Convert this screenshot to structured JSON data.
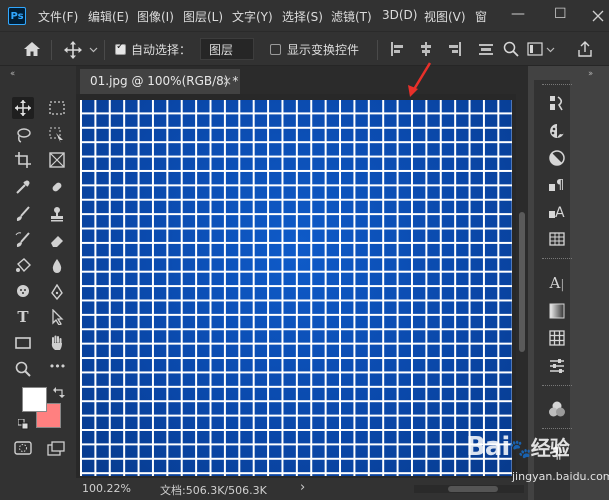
{
  "app": {
    "logo": "Ps"
  },
  "menu": [
    "文件(F)",
    "编辑(E)",
    "图像(I)",
    "图层(L)",
    "文字(Y)",
    "选择(S)",
    "滤镜(T)",
    "3D(D)",
    "视图(V)",
    "窗"
  ],
  "window_controls": {
    "minimize": "—",
    "maximize": "☐"
  },
  "options": {
    "auto_select_label": "自动选择：",
    "auto_select_checked": true,
    "target_value": "图层",
    "show_transform_label": "显示变换控件",
    "show_transform_checked": false
  },
  "document_tab": {
    "title": "01.jpg @ 100%(RGB/8) *",
    "close": "×"
  },
  "status": {
    "zoom": "100.22%",
    "doc_info": "文档:506.3K/506.3K",
    "arrow": "›"
  },
  "colors": {
    "foreground": "#ffffff",
    "background": "#ff8080",
    "accent": "#31a8ff",
    "image_blue": "#0a47a8",
    "annotation_arrow": "#e8302a"
  },
  "tools_left": [
    "move-tool",
    "marquee-tool",
    "lasso-tool",
    "object-select-tool",
    "crop-tool",
    "frame-tool",
    "eyedropper-tool",
    "healing-brush-tool",
    "brush-tool",
    "clone-stamp-tool",
    "history-brush-tool",
    "eraser-tool",
    "paint-bucket-tool",
    "blur-tool",
    "dodge-tool",
    "pen-tool",
    "type-tool",
    "path-select-tool",
    "rectangle-tool",
    "hand-tool",
    "zoom-tool",
    "more-tools",
    "quick-mask",
    "screen-mode"
  ],
  "tool_glyphs": {
    "type": "T",
    "more": "•••"
  },
  "right_panel_icons": [
    "history-icon",
    "color-icon",
    "adjustments-icon",
    "styles-icon",
    "character-icon",
    "grid-icon",
    "glyph-icon",
    "gradient-icon",
    "pattern-icon",
    "properties-icon",
    "channels-icon",
    "paragraph-icon"
  ],
  "right_glyphs": {
    "character": "A",
    "paragraph": "¶",
    "glyph_letter": "A"
  },
  "watermark": {
    "brand": "Bai",
    "brand_cn": "经验",
    "site": "jingyan.baidu.com"
  }
}
